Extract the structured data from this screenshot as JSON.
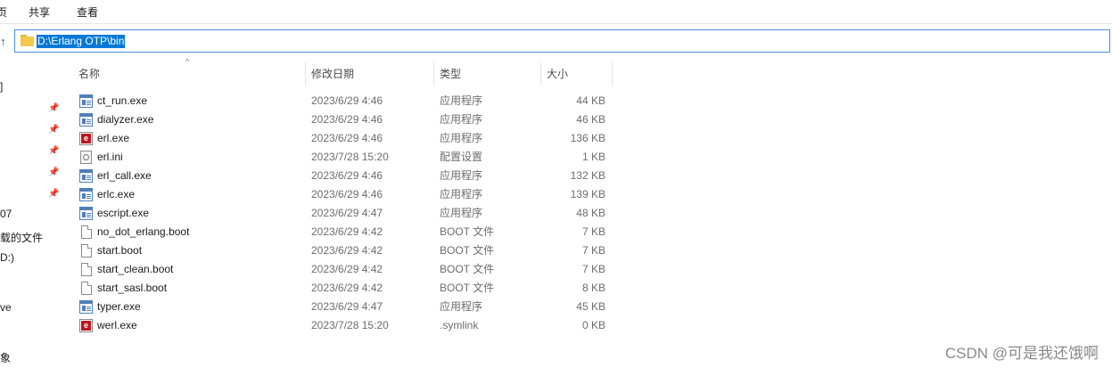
{
  "ribbon": {
    "tabs": [
      "页",
      "共享",
      "查看"
    ]
  },
  "address": {
    "path": "D:\\Erlang OTP\\bin"
  },
  "nav": {
    "items": [
      "]",
      "07",
      "载的文件",
      "D:)",
      "ve",
      "象"
    ]
  },
  "columns": {
    "name": "名称",
    "date": "修改日期",
    "type": "类型",
    "size": "大小"
  },
  "files": [
    {
      "name": "ct_run.exe",
      "date": "2023/6/29 4:46",
      "type": "应用程序",
      "size": "44 KB",
      "icon": "exe-icon"
    },
    {
      "name": "dialyzer.exe",
      "date": "2023/6/29 4:46",
      "type": "应用程序",
      "size": "46 KB",
      "icon": "exe-icon"
    },
    {
      "name": "erl.exe",
      "date": "2023/6/29 4:46",
      "type": "应用程序",
      "size": "136 KB",
      "icon": "erlang-icon"
    },
    {
      "name": "erl.ini",
      "date": "2023/7/28 15:20",
      "type": "配置设置",
      "size": "1 KB",
      "icon": "ini-icon"
    },
    {
      "name": "erl_call.exe",
      "date": "2023/6/29 4:46",
      "type": "应用程序",
      "size": "132 KB",
      "icon": "exe-icon"
    },
    {
      "name": "erlc.exe",
      "date": "2023/6/29 4:46",
      "type": "应用程序",
      "size": "139 KB",
      "icon": "exe-icon"
    },
    {
      "name": "escript.exe",
      "date": "2023/6/29 4:47",
      "type": "应用程序",
      "size": "48 KB",
      "icon": "exe-icon"
    },
    {
      "name": "no_dot_erlang.boot",
      "date": "2023/6/29 4:42",
      "type": "BOOT 文件",
      "size": "7 KB",
      "icon": "file-icon"
    },
    {
      "name": "start.boot",
      "date": "2023/6/29 4:42",
      "type": "BOOT 文件",
      "size": "7 KB",
      "icon": "file-icon"
    },
    {
      "name": "start_clean.boot",
      "date": "2023/6/29 4:42",
      "type": "BOOT 文件",
      "size": "7 KB",
      "icon": "file-icon"
    },
    {
      "name": "start_sasl.boot",
      "date": "2023/6/29 4:42",
      "type": "BOOT 文件",
      "size": "8 KB",
      "icon": "file-icon"
    },
    {
      "name": "typer.exe",
      "date": "2023/6/29 4:47",
      "type": "应用程序",
      "size": "45 KB",
      "icon": "exe-icon"
    },
    {
      "name": "werl.exe",
      "date": "2023/7/28 15:20",
      "type": ".symlink",
      "size": "0 KB",
      "icon": "erlang-icon"
    }
  ],
  "watermark": "CSDN @可是我还饿啊"
}
